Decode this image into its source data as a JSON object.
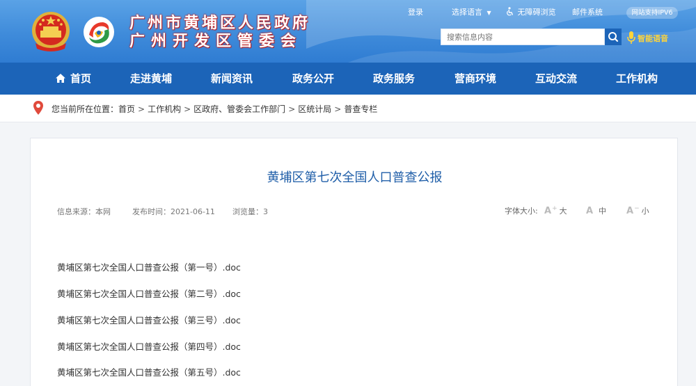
{
  "header": {
    "title_line1": "广州市黄埔区人民政府",
    "title_line2": "广州开发区管委会",
    "top_links": {
      "login": "登录",
      "language": "选择语言",
      "accessibility": "无障碍浏览",
      "mail": "邮件系统"
    },
    "ipv6_badge": "网站支持IPV6",
    "search_placeholder": "搜索信息内容",
    "voice_label": "智能语音"
  },
  "nav": {
    "items": [
      {
        "label": "首页"
      },
      {
        "label": "走进黄埔"
      },
      {
        "label": "新闻资讯"
      },
      {
        "label": "政务公开"
      },
      {
        "label": "政务服务"
      },
      {
        "label": "营商环境"
      },
      {
        "label": "互动交流"
      },
      {
        "label": "工作机构"
      }
    ]
  },
  "breadcrumb": {
    "prefix": "您当前所在位置：",
    "items": [
      "首页",
      "工作机构",
      "区政府、管委会工作部门",
      "区统计局",
      "普查专栏"
    ],
    "separator": ">"
  },
  "article": {
    "title": "黄埔区第七次全国人口普查公报",
    "source": "信息来源：本网",
    "published": "发布时间：2021-06-11",
    "views": "浏览量：3",
    "font_size_label": "字体大小:",
    "font_large": "大",
    "font_medium": "中",
    "font_small": "小",
    "attachments": [
      "黄埔区第七次全国人口普查公报（第一号）.doc",
      "黄埔区第七次全国人口普查公报（第二号）.doc",
      "黄埔区第七次全国人口普查公报（第三号）.doc",
      "黄埔区第七次全国人口普查公报（第四号）.doc",
      "黄埔区第七次全国人口普查公报（第五号）.doc"
    ]
  },
  "colors": {
    "header_blue": "#3f8bda",
    "nav_blue": "#1c64b8",
    "title_blue": "#1f5ea8",
    "voice_yellow": "#ffd43a",
    "emblem_red": "#d42a1f",
    "pin_red": "#e04a3c"
  },
  "icons": {
    "home": "home-icon",
    "search": "search-icon",
    "mic": "microphone-icon",
    "location": "location-pin-icon",
    "accessibility": "wheelchair-icon",
    "dropdown": "caret-down-icon"
  }
}
